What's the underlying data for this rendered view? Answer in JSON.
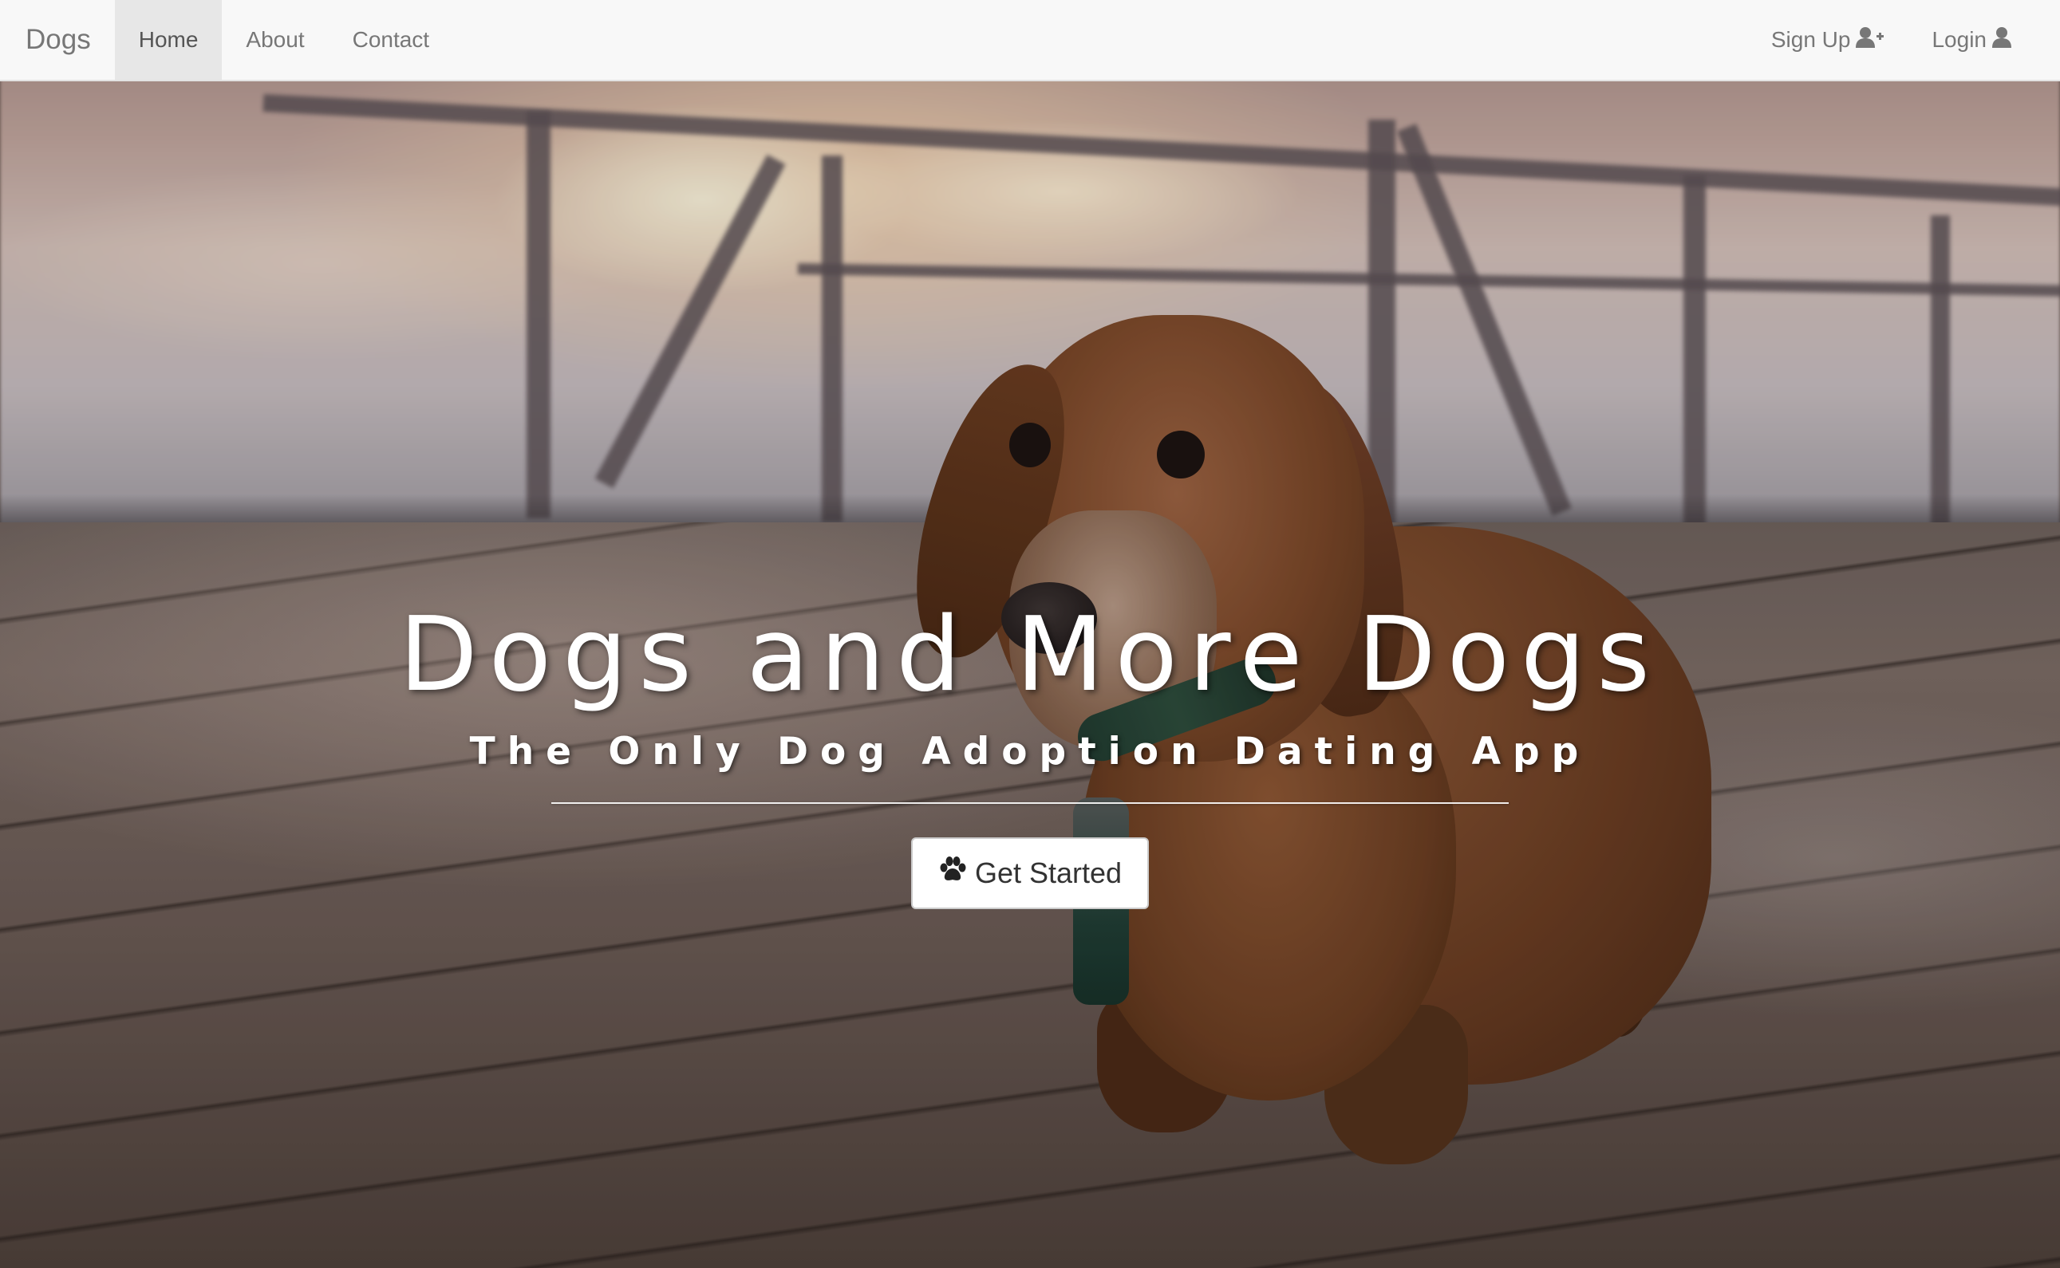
{
  "navbar": {
    "brand": "Dogs",
    "links": [
      {
        "label": "Home",
        "active": true
      },
      {
        "label": "About",
        "active": false
      },
      {
        "label": "Contact",
        "active": false
      }
    ],
    "right": [
      {
        "label": "Sign Up",
        "icon": "user-plus-icon"
      },
      {
        "label": "Login",
        "icon": "user-icon"
      }
    ]
  },
  "hero": {
    "title": "Dogs and More Dogs",
    "subtitle": "The Only Dog Adoption Dating App",
    "cta_label": "Get Started",
    "cta_icon": "paw-icon",
    "background": "dachshund-on-boardwalk-photo"
  },
  "colors": {
    "navbar_bg": "#f8f8f8",
    "nav_text": "#777777",
    "nav_active_bg": "#e7e7e7",
    "hero_text": "#ffffff",
    "button_bg": "#ffffff"
  }
}
